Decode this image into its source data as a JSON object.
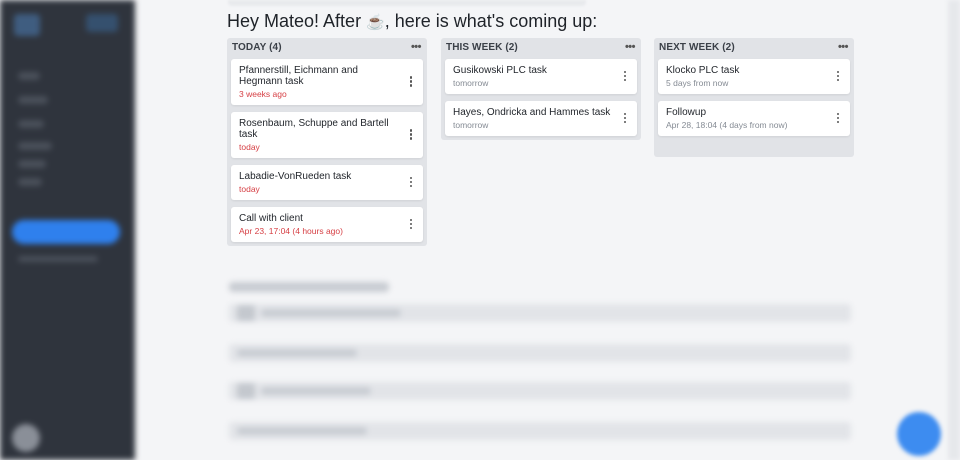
{
  "greeting": {
    "before": "Hey Mateo! After ",
    "coffee_icon": "☕",
    "after": ", here is what's coming up:"
  },
  "columns": [
    {
      "title": "TODAY (4)",
      "menu_glyph": "•••",
      "cards": [
        {
          "title": "Pfannerstill, Eichmann and Hegmann task",
          "due": "3 weeks ago"
        },
        {
          "title": "Rosenbaum, Schuppe and Bartell task",
          "due": "today"
        },
        {
          "title": "Labadie-VonRueden task",
          "due": "today"
        },
        {
          "title": "Call with client",
          "due": "Apr 23, 17:04 (4 hours ago)"
        }
      ]
    },
    {
      "title": "THIS WEEK (2)",
      "menu_glyph": "•••",
      "cards": [
        {
          "title": "Gusikowski PLC task",
          "due": "tomorrow"
        },
        {
          "title": "Hayes, Ondricka and Hammes task",
          "due": "tomorrow"
        }
      ]
    },
    {
      "title": "NEXT WEEK (2)",
      "menu_glyph": "•••",
      "cards": [
        {
          "title": "Klocko PLC task",
          "due": "5 days from now"
        },
        {
          "title": "Followup",
          "due": "Apr 28, 18:04 (4 days from now)"
        }
      ]
    }
  ],
  "colors": {
    "overdue_red": "#d64045",
    "sidebar_bg": "#2f343d",
    "accent_blue": "#3d8cf0"
  },
  "icons": {
    "coffee": "coffee-icon",
    "column_menu": "more-horizontal-icon",
    "card_menu": "more-vertical-icon",
    "fab": "fab-button"
  }
}
